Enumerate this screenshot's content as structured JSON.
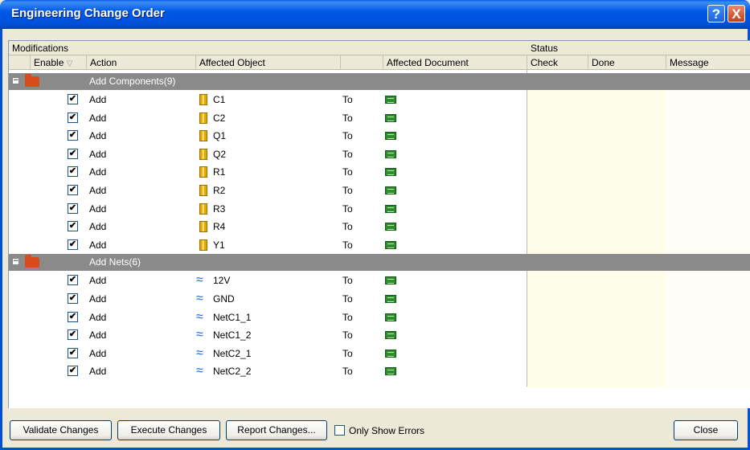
{
  "window": {
    "title": "Engineering Change Order",
    "help_glyph": "?",
    "close_glyph": "X"
  },
  "table": {
    "group_headers": {
      "modifications": "Modifications",
      "status": "Status"
    },
    "columns": {
      "enable": "Enable",
      "enable_sort_glyph": "▽",
      "action": "Action",
      "affected_object": "Affected Object",
      "affected_document": "Affected Document",
      "check": "Check",
      "done": "Done",
      "message": "Message"
    },
    "groups": [
      {
        "label": "Add Components(9)",
        "expander": "−",
        "object_icon": "component-icon",
        "rows": [
          {
            "enabled": true,
            "action": "Add",
            "object": "C1",
            "to": "To"
          },
          {
            "enabled": true,
            "action": "Add",
            "object": "C2",
            "to": "To"
          },
          {
            "enabled": true,
            "action": "Add",
            "object": "Q1",
            "to": "To"
          },
          {
            "enabled": true,
            "action": "Add",
            "object": "Q2",
            "to": "To"
          },
          {
            "enabled": true,
            "action": "Add",
            "object": "R1",
            "to": "To"
          },
          {
            "enabled": true,
            "action": "Add",
            "object": "R2",
            "to": "To"
          },
          {
            "enabled": true,
            "action": "Add",
            "object": "R3",
            "to": "To"
          },
          {
            "enabled": true,
            "action": "Add",
            "object": "R4",
            "to": "To"
          },
          {
            "enabled": true,
            "action": "Add",
            "object": "Y1",
            "to": "To"
          }
        ]
      },
      {
        "label": "Add Nets(6)",
        "expander": "−",
        "object_icon": "net-icon",
        "rows": [
          {
            "enabled": true,
            "action": "Add",
            "object": "12V",
            "to": "To"
          },
          {
            "enabled": true,
            "action": "Add",
            "object": "GND",
            "to": "To"
          },
          {
            "enabled": true,
            "action": "Add",
            "object": "NetC1_1",
            "to": "To"
          },
          {
            "enabled": true,
            "action": "Add",
            "object": "NetC1_2",
            "to": "To"
          },
          {
            "enabled": true,
            "action": "Add",
            "object": "NetC2_1",
            "to": "To"
          },
          {
            "enabled": true,
            "action": "Add",
            "object": "NetC2_2",
            "to": "To"
          }
        ]
      }
    ]
  },
  "footer": {
    "validate_label": "Validate Changes",
    "execute_label": "Execute Changes",
    "report_label": "Report Changes...",
    "only_errors_label": "Only Show Errors",
    "only_errors_checked": false,
    "close_label": "Close"
  },
  "colors": {
    "titlebar": "#0050d8",
    "group_row": "#8a8a8a",
    "folder": "#d94a1c",
    "status_bg": "#fdfde9"
  }
}
